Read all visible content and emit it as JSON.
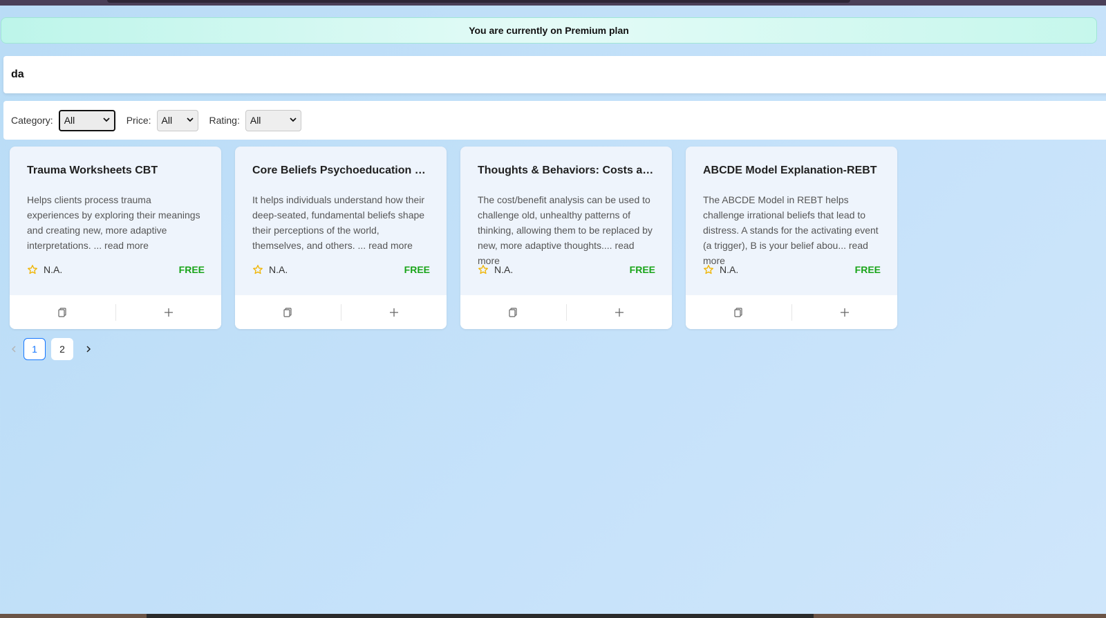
{
  "banner": {
    "text": "You are currently on Premium plan"
  },
  "search": {
    "value": "da"
  },
  "filters": [
    {
      "label": "Category:",
      "value": "All"
    },
    {
      "label": "Price:",
      "value": "All"
    },
    {
      "label": "Rating:",
      "value": "All"
    }
  ],
  "cards": [
    {
      "title": "Trauma Worksheets CBT",
      "description": "Helps clients process trauma experiences by exploring their meanings and creating new, more adaptive interpretations. ... read more",
      "rating": "N.A.",
      "price": "FREE"
    },
    {
      "title": "Core Beliefs Psychoeducation CBT",
      "description": "It helps individuals understand how their deep-seated, fundamental beliefs shape their perceptions of the world, themselves, and others. ... read more",
      "rating": "N.A.",
      "price": "FREE"
    },
    {
      "title": "Thoughts & Behaviors: Costs and B...",
      "description": "The cost/benefit analysis can be used to challenge old, unhealthy patterns of thinking, allowing them to be replaced by new, more adaptive thoughts.... read more",
      "rating": "N.A.",
      "price": "FREE"
    },
    {
      "title": "ABCDE Model Explanation-REBT",
      "description": "The ABCDE Model in REBT helps challenge irrational beliefs that lead to distress. A stands for the activating event (a trigger), B is your belief abou... read more",
      "rating": "N.A.",
      "price": "FREE"
    }
  ],
  "pagination": {
    "pages": [
      "1",
      "2"
    ],
    "current": "1"
  },
  "colors": {
    "price": "#18a418",
    "star": "#f0b400",
    "active_page": "#1677ff"
  },
  "icons": {
    "card_copy": "copy-icon",
    "card_add": "plus-icon",
    "rating": "star-icon"
  }
}
